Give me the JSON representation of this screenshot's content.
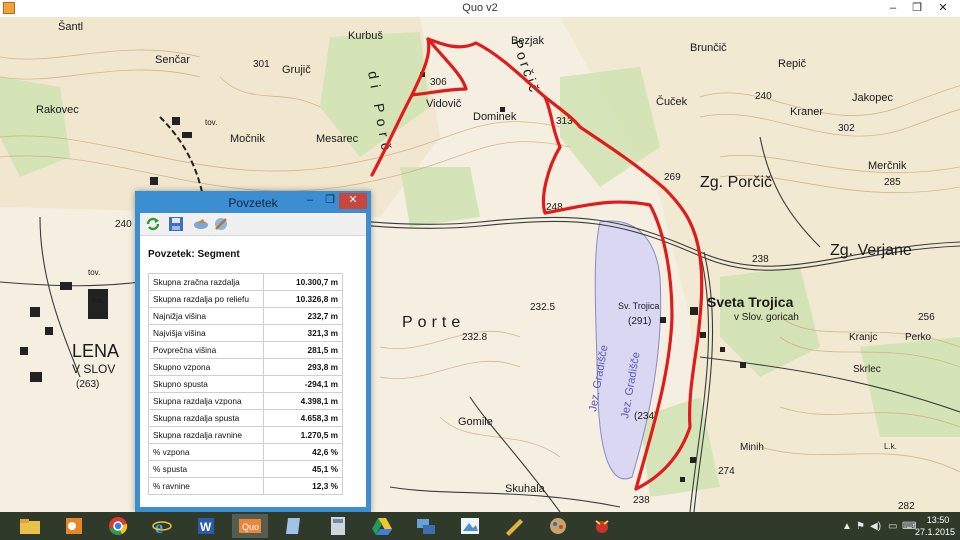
{
  "window": {
    "title": "Quo v2",
    "minimize": "–",
    "maximize": "❐",
    "close": "✕"
  },
  "map": {
    "places": [
      "Šantl",
      "Senčar",
      "Grujič",
      "Kurbuš",
      "Bezjak",
      "Brunčič",
      "Repič",
      "Jakopec",
      "Rakovec",
      "Močnik",
      "Mesarec",
      "Vidovič",
      "Dominek",
      "Čuček",
      "Kraner",
      "Merčnik",
      "Zg. Porčič",
      "Zg. Verjane",
      "Sveta Trojica",
      "v Slov. goricah",
      "Sv. Trojica",
      "Kranjc",
      "Perko",
      "Skrlec",
      "Minih",
      "Porte",
      "Gomile",
      "Skuhala",
      "LENA",
      "V SLOV",
      "Jez. Gradišče",
      "Jez. Gradišče",
      "Porčič",
      "di Porč",
      "tov.",
      "tov.",
      "tov.",
      "L.k."
    ],
    "heights": [
      "301",
      "306",
      "313",
      "240",
      "302",
      "269",
      "285",
      "248",
      "238",
      "256",
      "232.5",
      "232.8",
      "(291)",
      "(234)",
      "(263)",
      "274",
      "238",
      "282",
      "240"
    ]
  },
  "summary": {
    "title": "Povzetek",
    "heading": "Povzetek: Segment",
    "toolbar": [
      "refresh-icon",
      "save-icon",
      "export-icon",
      "tools-icon"
    ],
    "rows": [
      {
        "label": "Skupna zračna razdalja",
        "value": "10.300,7 m"
      },
      {
        "label": "Skupna razdalja po reliefu",
        "value": "10.326,8 m"
      },
      {
        "label": "Najnižja višina",
        "value": "232,7 m"
      },
      {
        "label": "Najvišja višina",
        "value": "321,3 m"
      },
      {
        "label": "Povprečna višina",
        "value": "281,5 m"
      },
      {
        "label": "Skupno vzpona",
        "value": "293,8 m"
      },
      {
        "label": "Skupno spusta",
        "value": "-294,1 m"
      },
      {
        "label": "Skupna razdalja vzpona",
        "value": "4.398,1 m"
      },
      {
        "label": "Skupna razdalja spusta",
        "value": "4.658,3 m"
      },
      {
        "label": "Skupna razdalja ravnine",
        "value": "1.270,5 m"
      },
      {
        "label": "% vzpona",
        "value": "42,6 %"
      },
      {
        "label": "% spusta",
        "value": "45,1 %"
      },
      {
        "label": "% ravnine",
        "value": "12,3 %"
      }
    ]
  },
  "taskbar": {
    "apps": [
      "file-explorer-icon",
      "outlook-icon",
      "chrome-icon",
      "internet-explorer-icon",
      "word-icon",
      "quo-icon",
      "notes-icon",
      "calculator-icon",
      "google-drive-icon",
      "network-icon",
      "paint-icon",
      "ruler-tool-icon",
      "picture-viewer-icon",
      "bug-app-icon"
    ],
    "active_app": "Quo",
    "tray_icons": [
      "network-tray-icon",
      "flag-tray-icon",
      "volume-tray-icon",
      "monitor-tray-icon",
      "keyboard-tray-icon"
    ],
    "time": "13:50",
    "date": "27.1.2015"
  },
  "colors": {
    "route": "#e01b1b",
    "window_accent": "#3c8ed3",
    "taskbar": "#2f3a2a",
    "lake": "#d9d7f1"
  }
}
